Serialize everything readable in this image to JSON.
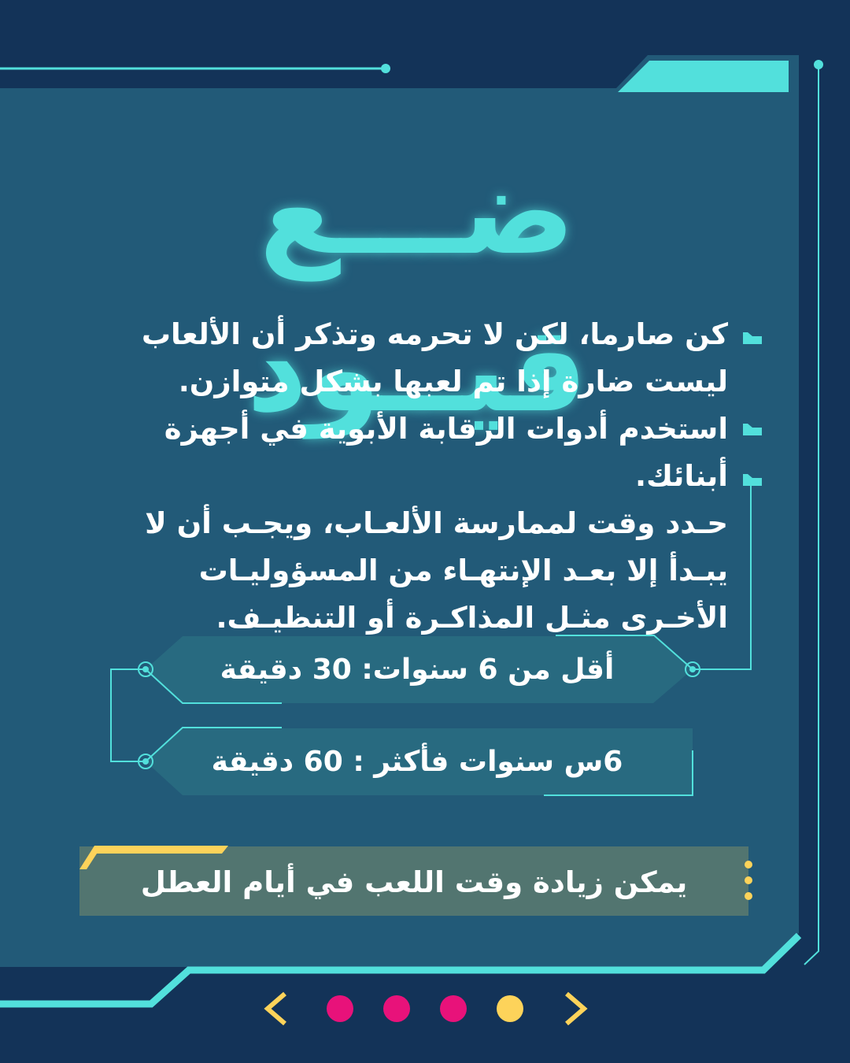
{
  "title": "ضـــع قيــود",
  "bullets": [
    "كن صارما، لكن لا تحرمه وتذكر أن الألعاب ليست ضارة إذا تم لعبها بشكل متوازن.",
    "استخدم أدوات الرقابة الأبوية في أجهزة أبنائك.",
    "حـدد وقت لممارسة الألعـاب، ويجـب أن لا يبـدأ إلا بعـد الإنتهـاء من المسؤوليـات الأخـرى مثـل المذاكـرة أو التنظيـف."
  ],
  "age_limits": [
    "أقل من 6 سنوات: 30 دقيقة",
    "6س سنوات فأكثر : 60 دقيقة"
  ],
  "note": "يمكن زيادة وقت اللعب في أيام العطل",
  "pagination": {
    "pages": 4,
    "current": 4
  },
  "colors": {
    "background": "#133358",
    "panel": "#225a78",
    "accent": "#52e0dc",
    "dot": "#e8127a",
    "active": "#fdd35a",
    "note_bg": "#527570"
  }
}
